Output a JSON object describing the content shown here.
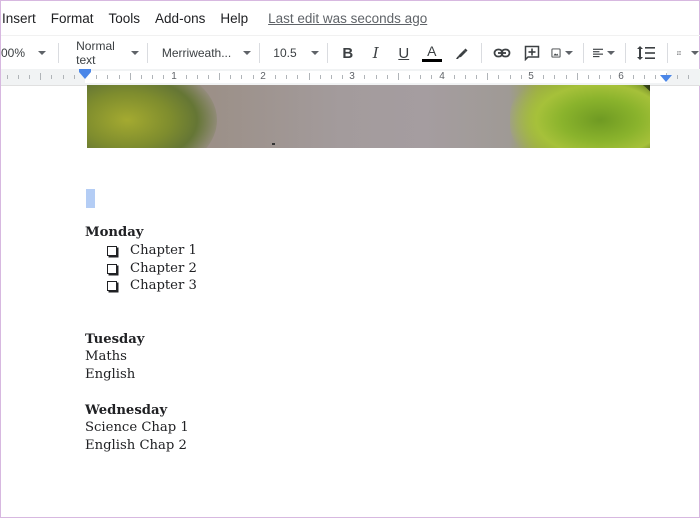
{
  "menubar": {
    "items": [
      "Insert",
      "Format",
      "Tools",
      "Add-ons",
      "Help"
    ],
    "last_edit": "Last edit was seconds ago"
  },
  "toolbar": {
    "zoom": "00%",
    "style": "Normal text",
    "font": "Merriweath...",
    "font_size": "10.5",
    "buttons": {
      "bold": "B",
      "italic": "I",
      "underline": "U",
      "text_color": "A"
    },
    "text_color_hex": "#000000"
  },
  "ruler": {
    "numbers": [
      "1",
      "2",
      "3",
      "4",
      "5",
      "6"
    ]
  },
  "document": {
    "sections": [
      {
        "heading": "Monday",
        "checklist": [
          "Chapter 1",
          "Chapter 2",
          "Chapter 3"
        ]
      },
      {
        "heading": "Tuesday",
        "lines": [
          "Maths",
          "English"
        ]
      },
      {
        "heading": "Wednesday",
        "lines": [
          "Science Chap 1",
          "English Chap 2"
        ]
      }
    ]
  },
  "colors": {
    "accent": "#4a86e8",
    "selection": "#b4cdf5"
  }
}
